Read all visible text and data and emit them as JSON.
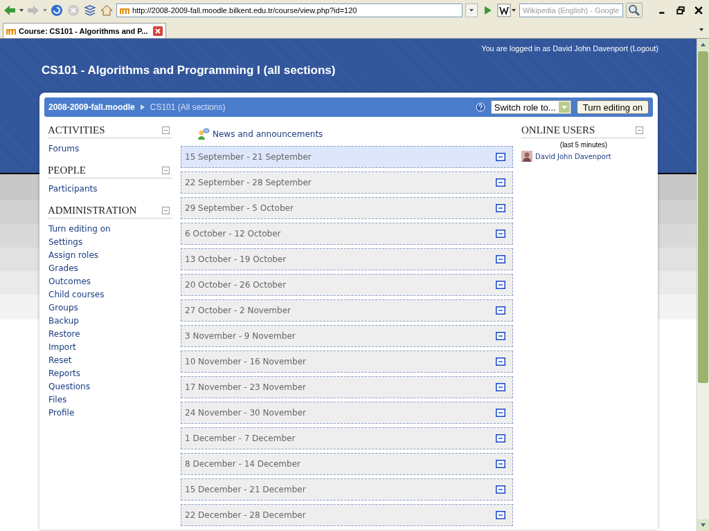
{
  "browser": {
    "url": "http://2008-2009-fall.moodle.bilkent.edu.tr/course/view.php?id=120",
    "search_placeholder": "Wikipedia (English) - Google",
    "tab_title": "Course: CS101 - Algorithms and P..."
  },
  "header": {
    "login_text": "You are logged in as David John Davenport (Logout)",
    "course_title": "CS101 - Algorithms and Programming I (all sections)"
  },
  "navbar": {
    "breadcrumbs": [
      "2008-2009-fall.moodle",
      "CS101 (All sections)"
    ],
    "role_select": "Switch role to...",
    "edit_button": "Turn editing on"
  },
  "left_blocks": [
    {
      "title": "ACTIVITIES",
      "items": [
        "Forums"
      ]
    },
    {
      "title": "PEOPLE",
      "items": [
        "Participants"
      ]
    },
    {
      "title": "ADMINISTRATION",
      "items": [
        "Turn editing on",
        "Settings",
        "Assign roles",
        "Grades",
        "Outcomes",
        "Child courses",
        "Groups",
        "Backup",
        "Restore",
        "Import",
        "Reset",
        "Reports",
        "Questions",
        "Files",
        "Profile"
      ]
    }
  ],
  "news_link": "News and announcements",
  "weeks": [
    {
      "label": "15 September - 21 September",
      "current": true
    },
    {
      "label": "22 September - 28 September",
      "current": false
    },
    {
      "label": "29 September - 5 October",
      "current": false
    },
    {
      "label": "6 October - 12 October",
      "current": false
    },
    {
      "label": "13 October - 19 October",
      "current": false
    },
    {
      "label": "20 October - 26 October",
      "current": false
    },
    {
      "label": "27 October - 2 November",
      "current": false
    },
    {
      "label": "3 November - 9 November",
      "current": false
    },
    {
      "label": "10 November - 16 November",
      "current": false
    },
    {
      "label": "17 November - 23 November",
      "current": false
    },
    {
      "label": "24 November - 30 November",
      "current": false
    },
    {
      "label": "1 December - 7 December",
      "current": false
    },
    {
      "label": "8 December - 14 December",
      "current": false
    },
    {
      "label": "15 December - 21 December",
      "current": false
    },
    {
      "label": "22 December - 28 December",
      "current": false
    }
  ],
  "online_users": {
    "title": "ONLINE USERS",
    "subtitle": "(last 5 minutes)",
    "users": [
      "David John Davenport"
    ]
  }
}
